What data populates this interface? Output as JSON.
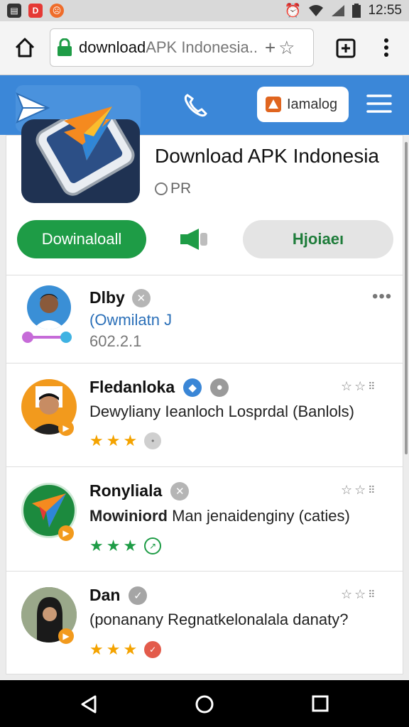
{
  "status_bar": {
    "time": "12:55",
    "icons": [
      "notification-icon-1",
      "notification-icon-2",
      "emoji-icon",
      "alarm-icon",
      "wifi-icon",
      "signal-icon",
      "battery-icon"
    ]
  },
  "browser": {
    "url_host": "download",
    "url_path": " APK Indonesia..",
    "icons": [
      "home-icon",
      "lock-icon",
      "add-icon",
      "star-icon",
      "new-tab-icon",
      "more-vert-icon"
    ]
  },
  "header": {
    "search_label": "Iamalog",
    "icons": [
      "paper-plane-logo",
      "phone-icon",
      "hamburger-menu-icon"
    ]
  },
  "app": {
    "title": "Download APK Indonesia",
    "subtitle": "PR",
    "download_label": "Dowinaloall",
    "alt_button_label": "Hjoiaeı"
  },
  "reviews": [
    {
      "name": "Dlby",
      "text": "(Owmilatn J",
      "extra": "602.2.1",
      "stars": 0
    },
    {
      "name": "Fledanloka",
      "text": "Dewyliany Ieanloch Losprdal (Banlols)",
      "stars": 3
    },
    {
      "name": "Ronyliala",
      "text_bold": "Mowiniord",
      "text": " Man jenaidenginy (caties)",
      "stars": 3
    },
    {
      "name": "Dan",
      "text": "(ponanany Regnatkelonalala danaty?",
      "stars": 3
    }
  ],
  "colors": {
    "header_blue": "#3b87d8",
    "download_green": "#1e9c46",
    "star_gold": "#f4a300"
  }
}
